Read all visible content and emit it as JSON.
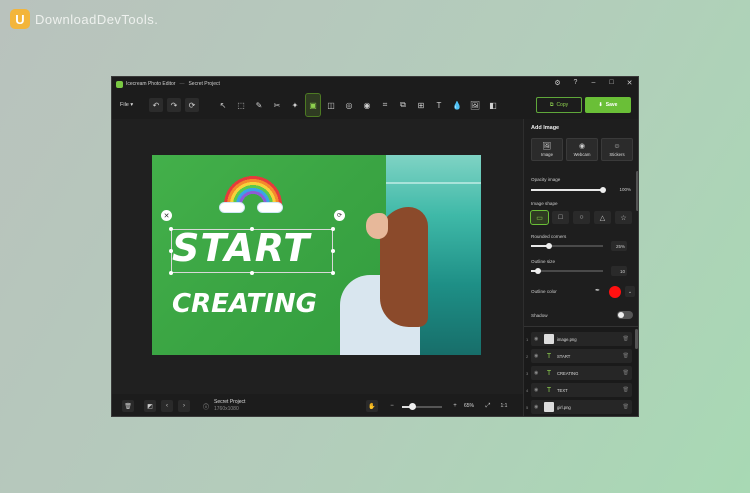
{
  "watermark": {
    "logo": "U",
    "text": "DownloadDevTools."
  },
  "window": {
    "app_name": "Icecream Photo Editor",
    "separator": "—",
    "project_name": "Secret Project",
    "controls": {
      "settings": "⚙",
      "help": "?",
      "minimize": "–",
      "maximize": "□",
      "close": "✕"
    }
  },
  "toolbar": {
    "file_label": "File ▾",
    "undo": "↶",
    "redo": "↷",
    "reset": "⟳",
    "tools": [
      "↖",
      "⬚",
      "✎",
      "✂",
      "✦",
      "▣",
      "◫",
      "◎",
      "◉",
      "⌗",
      "⧉",
      "⊞",
      "T",
      "💧",
      "🖼",
      "◧"
    ],
    "copy_label": "Copy",
    "save_label": "Save"
  },
  "canvas": {
    "start_text": "START",
    "creating_text": "CREATING",
    "delete_handle": "✕",
    "rotate_handle": "⟳"
  },
  "bottombar": {
    "trash": "🗑",
    "compare": "◩",
    "prev": "‹",
    "next": "›",
    "info": "ⓘ",
    "project_name": "Secret Project",
    "project_size": "1760x1080",
    "hand": "✋",
    "zoom_out": "−",
    "zoom_in": "+",
    "zoom_value": 0.65,
    "zoom_label": "65%",
    "fit": "⤢",
    "actual": "1:1"
  },
  "panel": {
    "title": "Add Image",
    "add_buttons": [
      {
        "icon": "🖼",
        "label": "Image"
      },
      {
        "icon": "◉",
        "label": "Webcam"
      },
      {
        "icon": "☺",
        "label": "Stickers"
      }
    ],
    "opacity": {
      "label": "Opacity image",
      "value": 100,
      "display": "100%"
    },
    "shape": {
      "label": "Image shape",
      "options": [
        "▭",
        "□",
        "○",
        "△",
        "☆"
      ],
      "selected": 0
    },
    "rounded": {
      "label": "Rounded corners",
      "value": 25,
      "display": "25%"
    },
    "outline_size": {
      "label": "Outline size",
      "value": 10,
      "display": "10"
    },
    "outline_color": {
      "label": "Outline color",
      "color": "#ff1010",
      "eyedropper": "✒",
      "chevron": "⌄"
    },
    "shadow": {
      "label": "Shadow",
      "enabled": false
    }
  },
  "layers": [
    {
      "num": "1",
      "name": "image.png",
      "kind": "image"
    },
    {
      "num": "2",
      "name": "START",
      "kind": "text"
    },
    {
      "num": "3",
      "name": "CREATING",
      "kind": "text"
    },
    {
      "num": "4",
      "name": "TEXT",
      "kind": "text"
    },
    {
      "num": "5",
      "name": "girl.png",
      "kind": "image"
    }
  ],
  "layer_icons": {
    "eye": "◉",
    "text": "T",
    "trash": "🗑"
  },
  "colors": {
    "accent": "#6abf37",
    "image_green": "#3aa443"
  }
}
